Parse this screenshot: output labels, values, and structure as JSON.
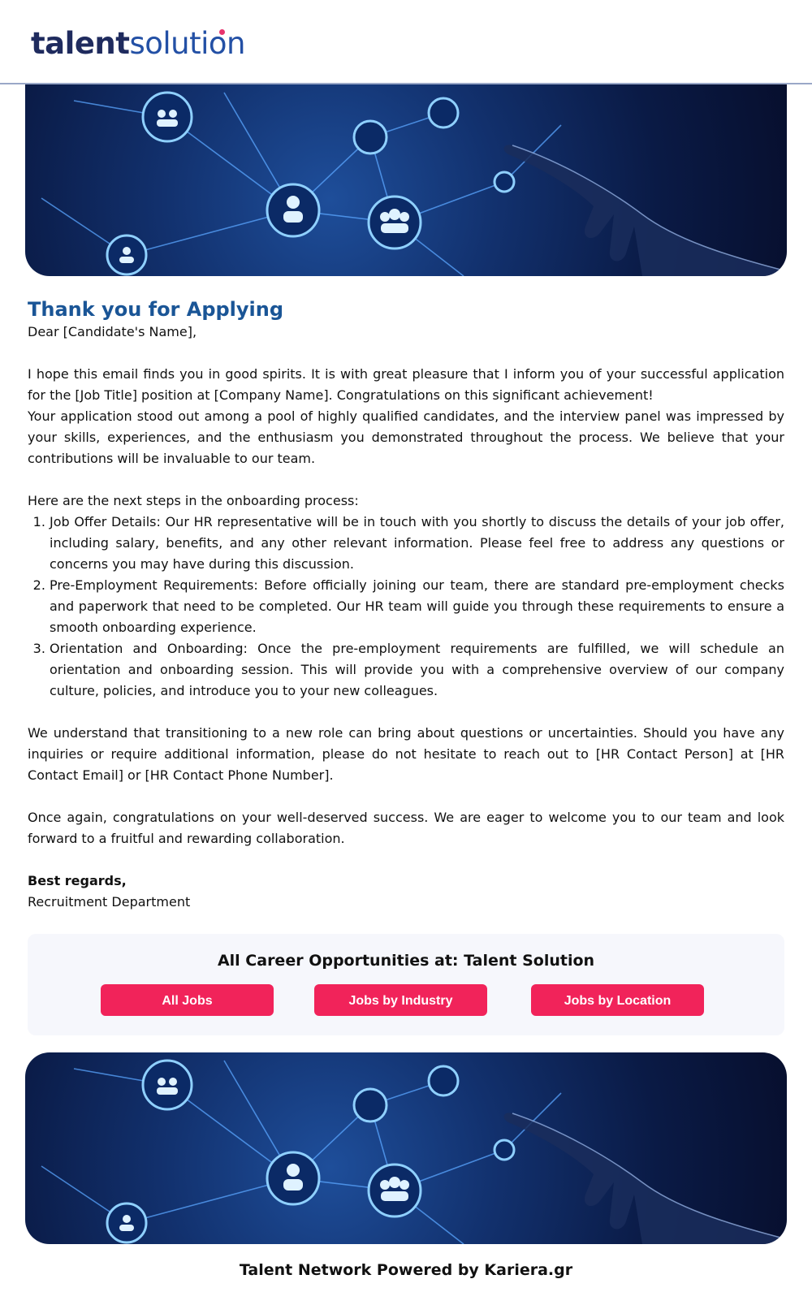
{
  "header": {
    "logo_part1": "talent",
    "logo_part2": "solution"
  },
  "colors": {
    "brand_dark": "#1f2b5e",
    "brand_blue": "#2350a5",
    "title_blue": "#1a5596",
    "button_pink": "#f1235a"
  },
  "letter": {
    "title": "Thank you for Applying",
    "greeting": "Dear [Candidate's Name],",
    "para1": "I hope this email finds you in good spirits. It is with great pleasure that I inform you of your successful application for the [Job Title] position at [Company Name]. Congratulations on this significant achievement!",
    "para2": "Your application stood out among a pool of highly qualified candidates, and the interview panel was impressed by your skills, experiences, and the enthusiasm you demonstrated throughout the process. We believe that your contributions will be invaluable to our team.",
    "steps_intro": "Here are the next steps in the onboarding process:",
    "steps": [
      "Job Offer Details: Our HR representative will be in touch with you shortly to discuss the details of your job offer, including salary, benefits, and any other relevant information. Please feel free to address any questions or concerns you may have during this discussion.",
      "Pre-Employment Requirements: Before officially joining our team, there are standard pre-employment checks and paperwork that need to be completed. Our HR team will guide you through these requirements to ensure a smooth onboarding experience.",
      "Orientation and Onboarding: Once the pre-employment requirements are fulfilled, we will schedule an orientation and onboarding session. This will provide you with a comprehensive overview of our company culture, policies, and introduce you to your new colleagues."
    ],
    "para3": "We understand that transitioning to a new role can bring about questions or uncertainties. Should you have any inquiries or require additional information, please do not hesitate to reach out to [HR Contact Person] at [HR Contact Email] or [HR Contact Phone Number].",
    "para4": "Once again, congratulations on your well-deserved success. We are eager to welcome you to our team and look forward to a fruitful and rewarding collaboration.",
    "signoff": "Best regards,",
    "signature": "Recruitment Department"
  },
  "cta": {
    "title": "All Career Opportunities at: Talent Solution",
    "buttons": [
      "All Jobs",
      "Jobs by Industry",
      "Jobs by Location"
    ]
  },
  "footer": {
    "text": "Talent Network Powered by Kariera.gr"
  }
}
